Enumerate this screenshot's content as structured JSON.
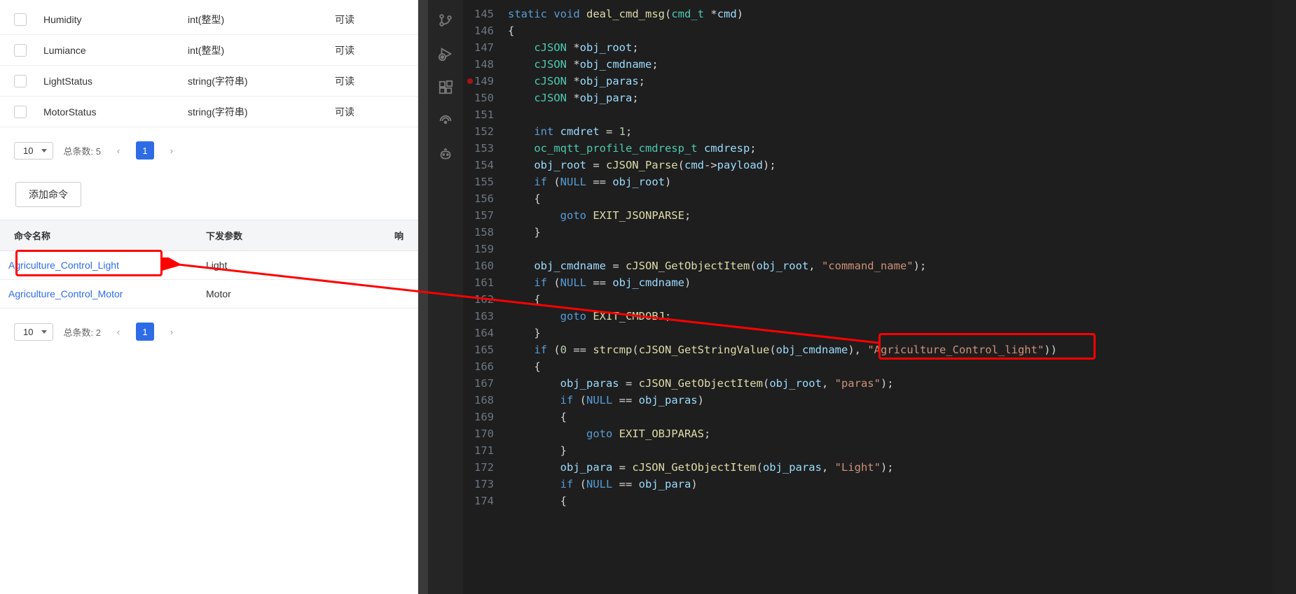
{
  "properties": {
    "rows": [
      {
        "name": "Humidity",
        "type": "int(整型)",
        "rw": "可读"
      },
      {
        "name": "Lumiance",
        "type": "int(整型)",
        "rw": "可读"
      },
      {
        "name": "LightStatus",
        "type": "string(字符串)",
        "rw": "可读"
      },
      {
        "name": "MotorStatus",
        "type": "string(字符串)",
        "rw": "可读"
      }
    ],
    "pager": {
      "size": "10",
      "totalLabel": "总条数:",
      "total": "5",
      "page": "1"
    }
  },
  "commands": {
    "addLabel": "添加命令",
    "headers": {
      "name": "命令名称",
      "params": "下发参数",
      "resp": "响"
    },
    "rows": [
      {
        "name": "Agriculture_Control_Light",
        "params": "Light"
      },
      {
        "name": "Agriculture_Control_Motor",
        "params": "Motor"
      }
    ],
    "pager": {
      "size": "10",
      "totalLabel": "总条数:",
      "total": "2",
      "page": "1"
    }
  },
  "code": {
    "startLine": 145,
    "lines": [
      {
        "n": 145,
        "seg": [
          [
            "kw",
            "static"
          ],
          [
            "op",
            " "
          ],
          [
            "kw",
            "void"
          ],
          [
            "op",
            " "
          ],
          [
            "nm",
            "deal_cmd_msg"
          ],
          [
            "pun",
            "("
          ],
          [
            "tp",
            "cmd_t"
          ],
          [
            "op",
            " *"
          ],
          [
            "fld",
            "cmd"
          ],
          [
            "pun",
            ")"
          ]
        ]
      },
      {
        "n": 146,
        "seg": [
          [
            "pun",
            "{"
          ]
        ]
      },
      {
        "n": 147,
        "seg": [
          [
            "op",
            "    "
          ],
          [
            "tp",
            "cJSON"
          ],
          [
            "op",
            " *"
          ],
          [
            "fld",
            "obj_root"
          ],
          [
            "pun",
            ";"
          ]
        ]
      },
      {
        "n": 148,
        "seg": [
          [
            "op",
            "    "
          ],
          [
            "tp",
            "cJSON"
          ],
          [
            "op",
            " *"
          ],
          [
            "fld",
            "obj_cmdname"
          ],
          [
            "pun",
            ";"
          ]
        ]
      },
      {
        "n": 149,
        "bp": true,
        "seg": [
          [
            "op",
            "    "
          ],
          [
            "tp",
            "cJSON"
          ],
          [
            "op",
            " *"
          ],
          [
            "fld",
            "obj_paras"
          ],
          [
            "pun",
            ";"
          ]
        ]
      },
      {
        "n": 150,
        "seg": [
          [
            "op",
            "    "
          ],
          [
            "tp",
            "cJSON"
          ],
          [
            "op",
            " *"
          ],
          [
            "fld",
            "obj_para"
          ],
          [
            "pun",
            ";"
          ]
        ]
      },
      {
        "n": 151,
        "seg": [
          [
            "op",
            ""
          ]
        ]
      },
      {
        "n": 152,
        "seg": [
          [
            "op",
            "    "
          ],
          [
            "kw",
            "int"
          ],
          [
            "op",
            " "
          ],
          [
            "fld",
            "cmdret"
          ],
          [
            "op",
            " = "
          ],
          [
            "num",
            "1"
          ],
          [
            "pun",
            ";"
          ]
        ]
      },
      {
        "n": 153,
        "seg": [
          [
            "op",
            "    "
          ],
          [
            "tp",
            "oc_mqtt_profile_cmdresp_t"
          ],
          [
            "op",
            " "
          ],
          [
            "fld",
            "cmdresp"
          ],
          [
            "pun",
            ";"
          ]
        ]
      },
      {
        "n": 154,
        "seg": [
          [
            "op",
            "    "
          ],
          [
            "fld",
            "obj_root"
          ],
          [
            "op",
            " = "
          ],
          [
            "nm",
            "cJSON_Parse"
          ],
          [
            "pun",
            "("
          ],
          [
            "fld",
            "cmd"
          ],
          [
            "op",
            "->"
          ],
          [
            "fld",
            "payload"
          ],
          [
            "pun",
            ");"
          ]
        ]
      },
      {
        "n": 155,
        "seg": [
          [
            "op",
            "    "
          ],
          [
            "kw",
            "if"
          ],
          [
            "op",
            " ("
          ],
          [
            "kw",
            "NULL"
          ],
          [
            "op",
            " == "
          ],
          [
            "fld",
            "obj_root"
          ],
          [
            "pun",
            ")"
          ]
        ]
      },
      {
        "n": 156,
        "seg": [
          [
            "op",
            "    "
          ],
          [
            "pun",
            "{"
          ]
        ]
      },
      {
        "n": 157,
        "seg": [
          [
            "op",
            "        "
          ],
          [
            "kw",
            "goto"
          ],
          [
            "op",
            " "
          ],
          [
            "lbl",
            "EXIT_JSONPARSE"
          ],
          [
            "pun",
            ";"
          ]
        ]
      },
      {
        "n": 158,
        "seg": [
          [
            "op",
            "    "
          ],
          [
            "pun",
            "}"
          ]
        ]
      },
      {
        "n": 159,
        "seg": [
          [
            "op",
            ""
          ]
        ]
      },
      {
        "n": 160,
        "seg": [
          [
            "op",
            "    "
          ],
          [
            "fld",
            "obj_cmdname"
          ],
          [
            "op",
            " = "
          ],
          [
            "nm",
            "cJSON_GetObjectItem"
          ],
          [
            "pun",
            "("
          ],
          [
            "fld",
            "obj_root"
          ],
          [
            "pun",
            ", "
          ],
          [
            "str",
            "\"command_name\""
          ],
          [
            "pun",
            ");"
          ]
        ]
      },
      {
        "n": 161,
        "seg": [
          [
            "op",
            "    "
          ],
          [
            "kw",
            "if"
          ],
          [
            "op",
            " ("
          ],
          [
            "kw",
            "NULL"
          ],
          [
            "op",
            " == "
          ],
          [
            "fld",
            "obj_cmdname"
          ],
          [
            "pun",
            ")"
          ]
        ]
      },
      {
        "n": 162,
        "seg": [
          [
            "op",
            "    "
          ],
          [
            "pun",
            "{"
          ]
        ]
      },
      {
        "n": 163,
        "seg": [
          [
            "op",
            "        "
          ],
          [
            "kw",
            "goto"
          ],
          [
            "op",
            " "
          ],
          [
            "lbl",
            "EXIT_CMDOBJ"
          ],
          [
            "pun",
            ";"
          ]
        ]
      },
      {
        "n": 164,
        "seg": [
          [
            "op",
            "    "
          ],
          [
            "pun",
            "}"
          ]
        ]
      },
      {
        "n": 165,
        "seg": [
          [
            "op",
            "    "
          ],
          [
            "kw",
            "if"
          ],
          [
            "op",
            " ("
          ],
          [
            "num",
            "0"
          ],
          [
            "op",
            " == "
          ],
          [
            "nm",
            "strcmp"
          ],
          [
            "pun",
            "("
          ],
          [
            "nm",
            "cJSON_GetStringValue"
          ],
          [
            "pun",
            "("
          ],
          [
            "fld",
            "obj_cmdname"
          ],
          [
            "pun",
            "), "
          ],
          [
            "str",
            "\"Agriculture_Control_light\""
          ],
          [
            "pun",
            "))"
          ]
        ]
      },
      {
        "n": 166,
        "seg": [
          [
            "op",
            "    "
          ],
          [
            "pun",
            "{"
          ]
        ]
      },
      {
        "n": 167,
        "seg": [
          [
            "op",
            "        "
          ],
          [
            "fld",
            "obj_paras"
          ],
          [
            "op",
            " = "
          ],
          [
            "nm",
            "cJSON_GetObjectItem"
          ],
          [
            "pun",
            "("
          ],
          [
            "fld",
            "obj_root"
          ],
          [
            "pun",
            ", "
          ],
          [
            "str",
            "\"paras\""
          ],
          [
            "pun",
            ");"
          ]
        ]
      },
      {
        "n": 168,
        "seg": [
          [
            "op",
            "        "
          ],
          [
            "kw",
            "if"
          ],
          [
            "op",
            " ("
          ],
          [
            "kw",
            "NULL"
          ],
          [
            "op",
            " == "
          ],
          [
            "fld",
            "obj_paras"
          ],
          [
            "pun",
            ")"
          ]
        ]
      },
      {
        "n": 169,
        "seg": [
          [
            "op",
            "        "
          ],
          [
            "pun",
            "{"
          ]
        ]
      },
      {
        "n": 170,
        "seg": [
          [
            "op",
            "            "
          ],
          [
            "kw",
            "goto"
          ],
          [
            "op",
            " "
          ],
          [
            "lbl",
            "EXIT_OBJPARAS"
          ],
          [
            "pun",
            ";"
          ]
        ]
      },
      {
        "n": 171,
        "seg": [
          [
            "op",
            "        "
          ],
          [
            "pun",
            "}"
          ]
        ]
      },
      {
        "n": 172,
        "seg": [
          [
            "op",
            "        "
          ],
          [
            "fld",
            "obj_para"
          ],
          [
            "op",
            " = "
          ],
          [
            "nm",
            "cJSON_GetObjectItem"
          ],
          [
            "pun",
            "("
          ],
          [
            "fld",
            "obj_paras"
          ],
          [
            "pun",
            ", "
          ],
          [
            "str",
            "\"Light\""
          ],
          [
            "pun",
            ");"
          ]
        ]
      },
      {
        "n": 173,
        "seg": [
          [
            "op",
            "        "
          ],
          [
            "kw",
            "if"
          ],
          [
            "op",
            " ("
          ],
          [
            "kw",
            "NULL"
          ],
          [
            "op",
            " == "
          ],
          [
            "fld",
            "obj_para"
          ],
          [
            "pun",
            ")"
          ]
        ]
      },
      {
        "n": 174,
        "seg": [
          [
            "op",
            "        "
          ],
          [
            "pun",
            "{"
          ]
        ]
      }
    ]
  },
  "icons": {
    "git": "git-branch-icon",
    "debug": "debug-icon",
    "ext": "extensions-icon",
    "remote": "remote-icon",
    "copilot": "copilot-icon"
  }
}
